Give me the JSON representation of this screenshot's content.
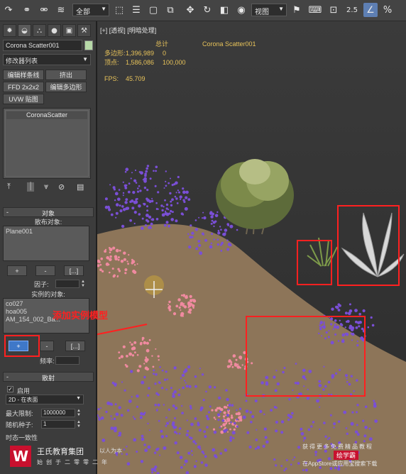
{
  "toolbar": {
    "selection_filter": "全部",
    "coord_system": "视图",
    "snap_value": "2.5",
    "icons": [
      "redo-icon",
      "link-icon",
      "unlink-icon",
      "bind-space-warp-icon",
      "select-object-icon",
      "select-by-name-icon",
      "rect-selection-icon",
      "window-crossing-icon",
      "move-icon",
      "rotate-icon",
      "scale-icon",
      "pivot-icon",
      "select-manipulate-icon",
      "keyboard-shortcut-icon",
      "snap-toggle-icon",
      "angle-snap-icon",
      "percent-snap-icon",
      "spinner-snap-icon"
    ]
  },
  "panel": {
    "tab_icons": [
      "create-tab-icon",
      "modify-tab-icon",
      "hierarchy-tab-icon",
      "motion-tab-icon",
      "display-tab-icon",
      "utilities-tab-icon"
    ],
    "object_name": "Corona Scatter001",
    "modifier_list": "修改器列表",
    "buttons": {
      "edit_spline": "编辑样条线",
      "extrude": "挤出",
      "ffd": "FFD 2x2x2",
      "edit_poly": "编辑多边形",
      "uvw": "UVW 贴图"
    },
    "stack_item": "CoronaScatter",
    "object_section": {
      "sign": "-",
      "title": "对象",
      "distribute_label": "散布对象:",
      "distribute_items": [
        "Plane001"
      ],
      "add": "+",
      "remove": "-",
      "more": "[...]",
      "factor_label": "因子:",
      "instance_label": "实例的对象:",
      "instance_items": [
        "co027",
        "hoa005",
        "AM_154_002_Ba..."
      ],
      "add_blue": "+",
      "remove2": "-",
      "more2": "[...]",
      "freq_label": "频率:"
    },
    "distribution_section": {
      "sign": "-",
      "title": "散射",
      "enable_label": "启用",
      "enable_checked": "✓",
      "mode": "2D - 在表面",
      "max_limit_label": "最大限制:",
      "max_limit_value": "1000000",
      "seed_label": "随机种子:",
      "seed_value": "1",
      "time_label": "时态一致性"
    }
  },
  "viewport": {
    "label": "[+] [透视] [明暗处理]",
    "stats": {
      "total_label": "总计",
      "object_name": "Corona Scatter001",
      "poly_label": "多边形:",
      "poly_total": "1,396,989",
      "poly_sel": "0",
      "vert_label": "顶点:",
      "vert_total": "1,586,086",
      "vert_sel": "100,000",
      "fps_label": "FPS:",
      "fps_value": "45.709"
    }
  },
  "annotation": {
    "text": "添加实例模型",
    "color": "#ff2020"
  },
  "watermark": {
    "logo": "W",
    "name": "王氏教育集团",
    "slogan": "以人为本",
    "motto": "始创于二零零二年",
    "right_line1": "获得更多免费精品教程",
    "right_badge": "绘学霸",
    "right_line3": "在AppStore或应用宝搜索下载"
  },
  "colors": {
    "toolbar_bg": "#444444",
    "panel_bg": "#3c3c3c",
    "accent_blue": "#3f78c8",
    "annotation_red": "#ff2020",
    "stats_yellow": "#e8c35a"
  }
}
